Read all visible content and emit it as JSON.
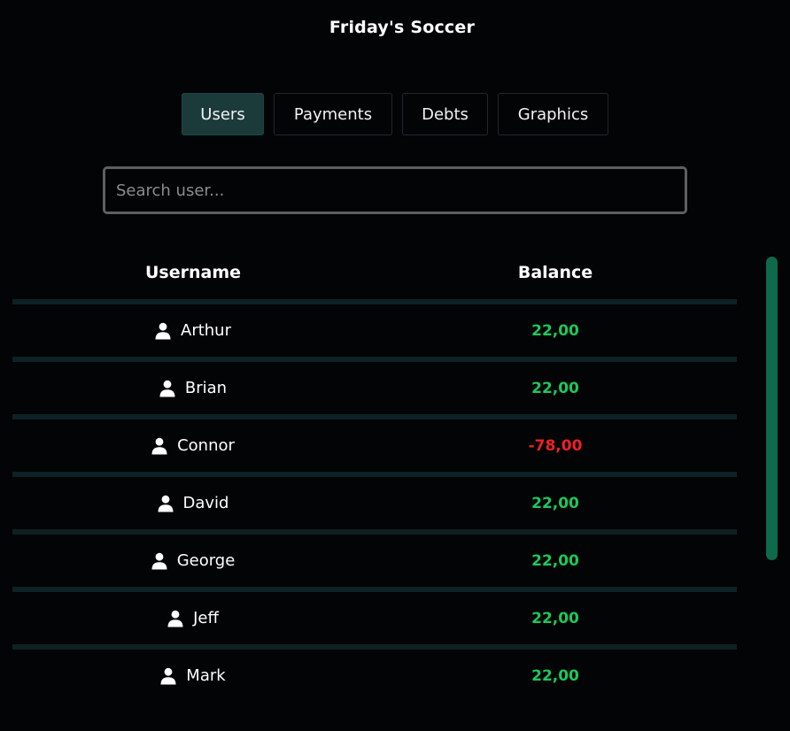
{
  "app": {
    "title": "Friday's Soccer"
  },
  "tabs": [
    {
      "label": "Users",
      "active": true
    },
    {
      "label": "Payments",
      "active": false
    },
    {
      "label": "Debts",
      "active": false
    },
    {
      "label": "Graphics",
      "active": false
    }
  ],
  "search": {
    "placeholder": "Search user...",
    "value": ""
  },
  "table": {
    "headers": {
      "username": "Username",
      "balance": "Balance"
    },
    "rows": [
      {
        "name": "Arthur",
        "balance": "22,00",
        "status": "positive"
      },
      {
        "name": "Brian",
        "balance": "22,00",
        "status": "positive"
      },
      {
        "name": "Connor",
        "balance": "-78,00",
        "status": "negative"
      },
      {
        "name": "David",
        "balance": "22,00",
        "status": "positive"
      },
      {
        "name": "George",
        "balance": "22,00",
        "status": "positive"
      },
      {
        "name": "Jeff",
        "balance": "22,00",
        "status": "positive"
      },
      {
        "name": "Mark",
        "balance": "22,00",
        "status": "positive"
      }
    ]
  },
  "icons": {
    "row_icon": "user-icon"
  },
  "colors": {
    "background": "#020406",
    "active_tab": "#1b3a3a",
    "row_separator": "#0e2124",
    "positive": "#1cc95a",
    "negative": "#ef2020",
    "scrollbar": "#0e6a4a"
  }
}
